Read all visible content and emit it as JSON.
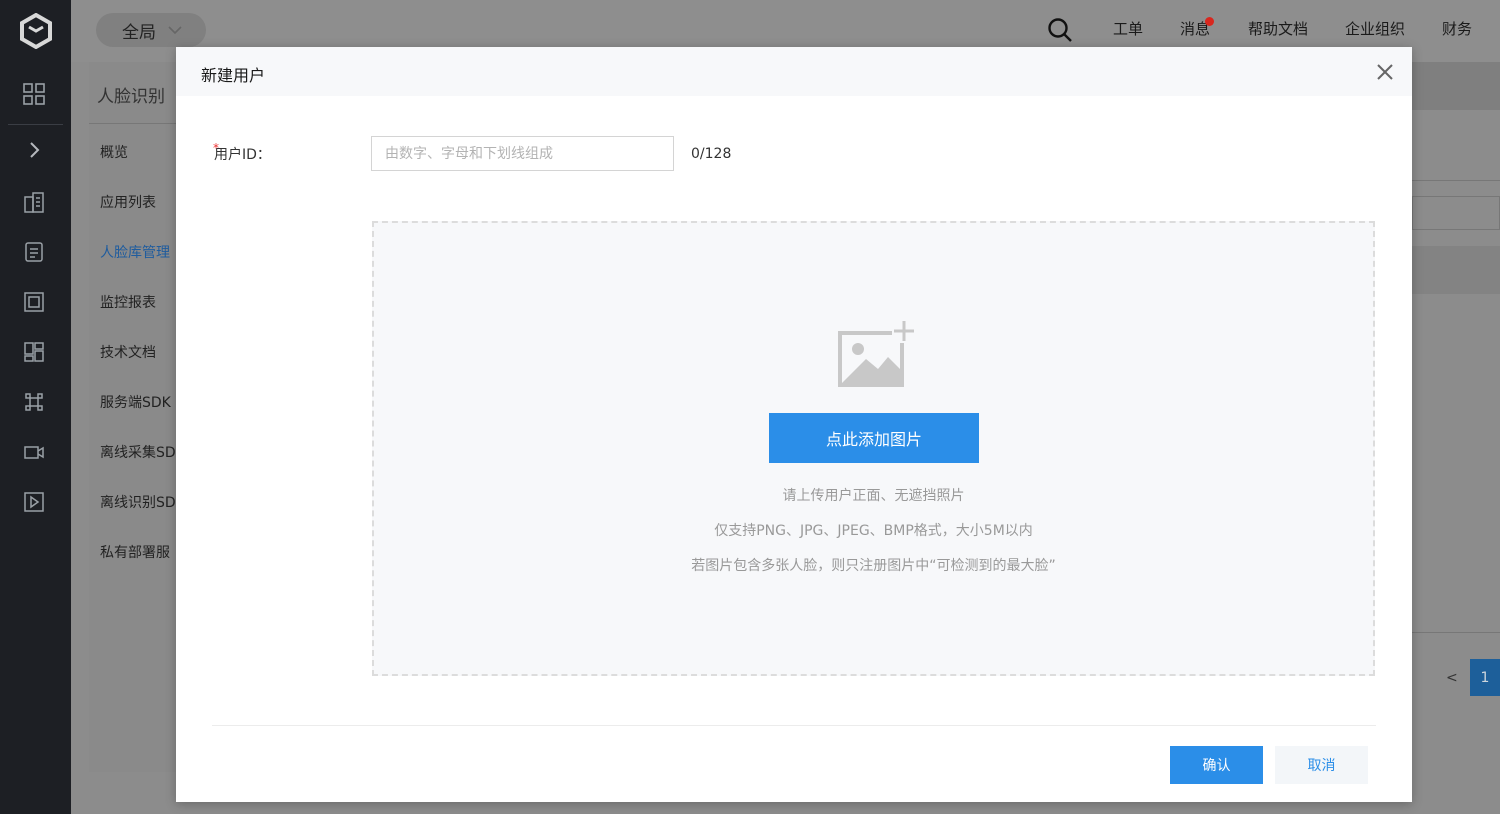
{
  "colors": {
    "rail_bg": "#1d1f24",
    "accent": "#2b8ee8",
    "badge_red": "#d9271e",
    "active_link": "#1f5c9e"
  },
  "topbar": {
    "scope_label": "全局",
    "nav": [
      "工单",
      "消息",
      "帮助文档",
      "企业组织",
      "财务"
    ]
  },
  "rail_icons": [
    "grid-icon",
    "chevron-right-icon",
    "building-icon",
    "database-icon",
    "frame-icon",
    "dashboard-icon",
    "command-icon",
    "video-icon",
    "play-icon"
  ],
  "sidebar": {
    "title": "人脸识别",
    "items": [
      {
        "label": "概览"
      },
      {
        "label": "应用列表"
      },
      {
        "label": "人脸库管理"
      },
      {
        "label": "监控报表"
      },
      {
        "label": "技术文档"
      },
      {
        "label": "服务端SDK"
      },
      {
        "label": "离线采集SD"
      },
      {
        "label": "离线识别SD"
      },
      {
        "label": "私有部署服"
      }
    ]
  },
  "pagination": {
    "prev": "<",
    "current": "1"
  },
  "modal": {
    "title": "新建用户",
    "field_label": "用户ID：",
    "field_placeholder": "由数字、字母和下划线组成",
    "field_counter": "0/128",
    "upload_button": "点此添加图片",
    "hints": [
      "请上传用户正面、无遮挡照片",
      "仅支持PNG、JPG、JPEG、BMP格式，大小5M以内",
      "若图片包含多张人脸，则只注册图片中“可检测到的最大脸”"
    ],
    "confirm_label": "确认",
    "cancel_label": "取消"
  }
}
